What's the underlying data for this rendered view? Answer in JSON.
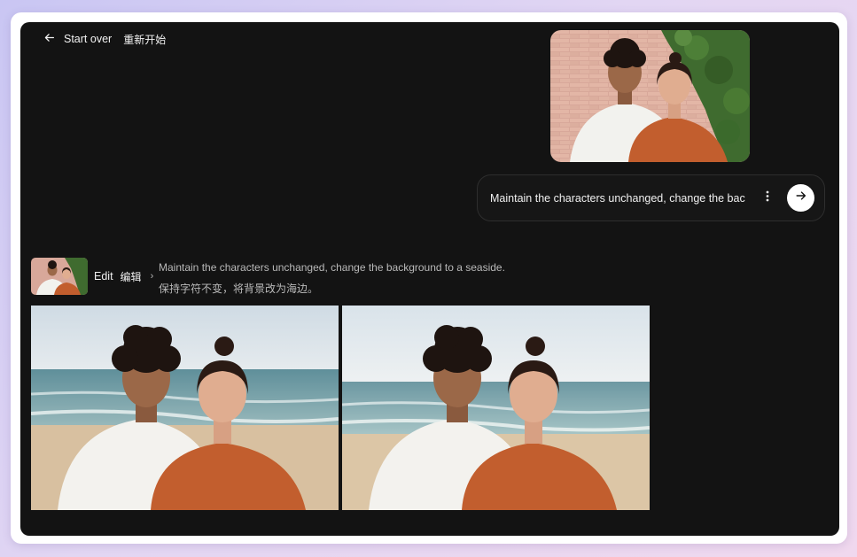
{
  "top_nav": {
    "back_label": "Start over",
    "back_label_zh": "重新开始"
  },
  "prompt": {
    "value": "Maintain the characters unchanged, change the bac"
  },
  "edit": {
    "label": "Edit",
    "label_zh": "编辑",
    "chevron": "›",
    "description": "Maintain the characters unchanged, change the background to a seaside.",
    "description_zh": "保持字符不变，将背景改为海边。"
  },
  "icons": {
    "back": "arrow-left-icon",
    "more": "vertical-dots-icon",
    "send": "arrow-right-icon"
  },
  "colors": {
    "app_background": "#131313",
    "send_button": "#ffffff",
    "page_gradient_start": "#c9c6f3",
    "page_gradient_end": "#f0d8ee"
  }
}
